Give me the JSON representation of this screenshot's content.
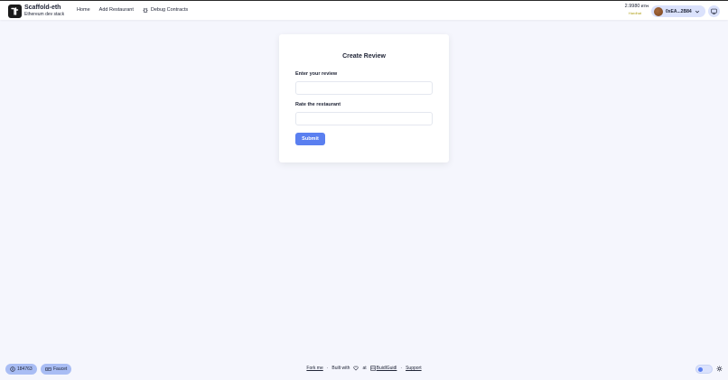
{
  "header": {
    "brand_title": "Scaffold-eth",
    "brand_subtitle": "Ethereum dev stack",
    "nav": [
      {
        "label": "Home"
      },
      {
        "label": "Add Restaurant"
      },
      {
        "label": "Debug Contracts",
        "icon": "bug-icon"
      }
    ],
    "balance_value": "2.9980",
    "balance_unit": "ETH",
    "network": "Hardhat",
    "account_address": "0xEA...2B84"
  },
  "form": {
    "title": "Create Review",
    "review_label": "Enter your review",
    "review_value": "",
    "rating_label": "Rate the restaurant",
    "rating_value": "",
    "submit_label": "Submit"
  },
  "footer": {
    "block_number": "184763",
    "faucet_label": "Faucet",
    "fork_label": "Fork me",
    "built_with": "Built with",
    "at": "at",
    "buidlguidl": "BuidlGuidl",
    "support": "Support",
    "separator": "·"
  },
  "colors": {
    "background": "#f5f6fd",
    "accent": "#5a7ff0",
    "pill": "#a9bdf4",
    "network": "#b1a11b"
  }
}
